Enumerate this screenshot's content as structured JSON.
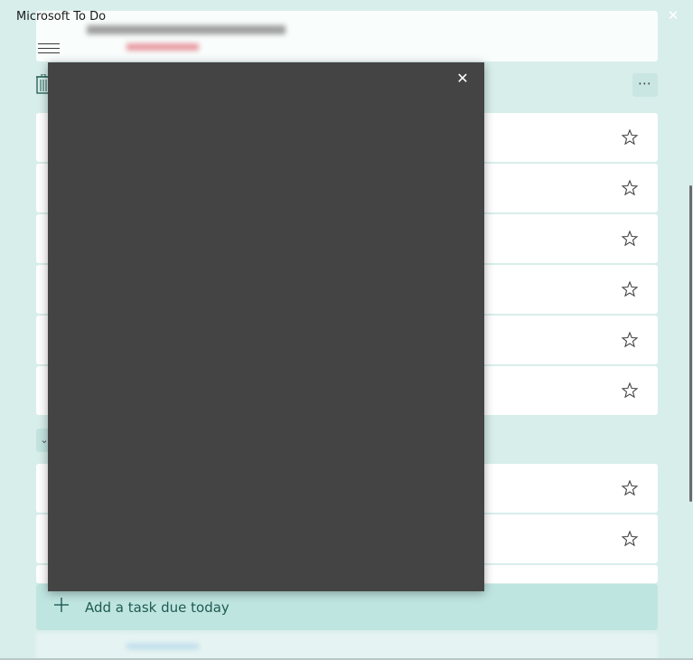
{
  "window": {
    "title": "Microsoft To Do",
    "close_glyph": "✕"
  },
  "toolbar": {
    "menu_icon": "hamburger-icon",
    "trash_icon": "trash-icon",
    "more_glyph": "⋯"
  },
  "tasks": {
    "rows": [
      {
        "star_icon": "star-outline-icon"
      },
      {
        "star_icon": "star-outline-icon"
      },
      {
        "star_icon": "star-outline-icon"
      },
      {
        "star_icon": "star-outline-icon"
      },
      {
        "star_icon": "star-outline-icon"
      },
      {
        "star_icon": "star-outline-icon"
      },
      {
        "star_icon": "star-outline-icon"
      },
      {
        "star_icon": "star-outline-icon"
      }
    ]
  },
  "add_task": {
    "label": "Add a task due today",
    "icon": "plus-icon"
  },
  "panel": {
    "close_glyph": "✕",
    "background": "#444444"
  },
  "colors": {
    "app_background": "#d8eeeb",
    "accent": "#1f5a53",
    "add_task_background": "#bfe5e0"
  }
}
